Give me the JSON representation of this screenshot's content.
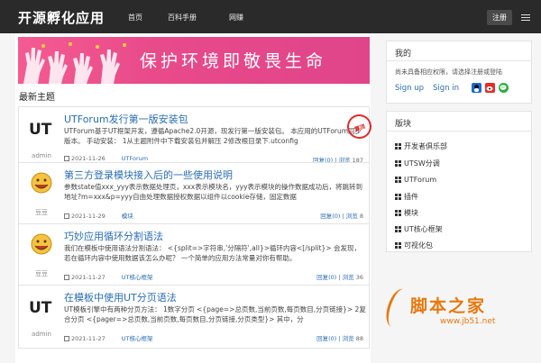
{
  "nav": {
    "brand": "开源孵化应用",
    "links": [
      "首页",
      "百科手册",
      "网赚"
    ],
    "register": "注册"
  },
  "banner": {
    "text": "保护环境即敬畏生命"
  },
  "main": {
    "section_title": "最新主题"
  },
  "topics": [
    {
      "title": "UTForum发行第一版安装包",
      "excerpt": "UTForum基于UT框架开发，遵循Apache2.0开源，现发行第一版安装包。 本应用的UTForum同步版本。 手动安装： 1从主题附件中下载安装包并解压 2修改根目录下.utconfig",
      "avatar_label": "UT",
      "author": "admin",
      "date": "2021-11-26",
      "category": "UTForum",
      "stats_prefix": "回复(0) | 浏览 ",
      "views": "187",
      "badge": "置顶"
    },
    {
      "title": "第三方登录模块接入后的一些使用说明",
      "excerpt": "参数state值xxx_yyy表示数据处理页，xxx表示模块名，yyy表示模块的操作数据成功后，将跳转到地址?m=xxx&p=yyy自由处理数据授权数据以组件以cookie存储，固定数据",
      "avatar_label": "笑",
      "author": "豆豆",
      "date": "2021-11-29",
      "category": "模块",
      "stats_prefix": "回复(0) | 浏览 ",
      "views": "8"
    },
    {
      "title": "巧妙应用循环分割语法",
      "excerpt": "我们在模板中使用语法分割语法： <{split=>字符串,'分隔符',all}>循环内容<[/split}> 会发现，若在循环内容中使用数据该怎么办呢？ 一个简单的应用方法常量对你有帮助。",
      "avatar_label": "笑",
      "author": "豆豆",
      "date": "2021-11-27",
      "category": "UT核心框架",
      "stats_prefix": "回复(0) | 浏览 ",
      "views": "36"
    },
    {
      "title": "在模板中使用UT分页语法",
      "excerpt": "UT模板引擎中有两种分页方法： 1数字分页 <{page=>总页数,当前页数,每页数目,分页链接}> 2复合分页 <{pager=>总页数,当前页数,每页数目,分页链接,分页类型}> 其中，分",
      "avatar_label": "UT",
      "author": "admin",
      "date": "2021-11-27",
      "category": "UT核心框架",
      "stats_prefix": "回复(0) | 浏览 ",
      "views": "88"
    }
  ],
  "sidebar": {
    "mine": {
      "title": "我的",
      "note": "尚未具备相应权限，请选择注册或登陆",
      "signup": "Sign up",
      "signin": "Sign in"
    },
    "forums": {
      "title": "版块",
      "items": [
        "开发者俱乐部",
        "UTSW分调",
        "UTForum",
        "插件",
        "模块",
        "UT核心框架",
        "可视化包"
      ]
    }
  },
  "watermark": {
    "text": "脚本之家",
    "url": "www.jb51.net"
  },
  "colors": {
    "link": "#2a6db2",
    "nav_bg": "#2a2a2a",
    "banner": "#e84a8a",
    "badge": "#e02c2c"
  }
}
